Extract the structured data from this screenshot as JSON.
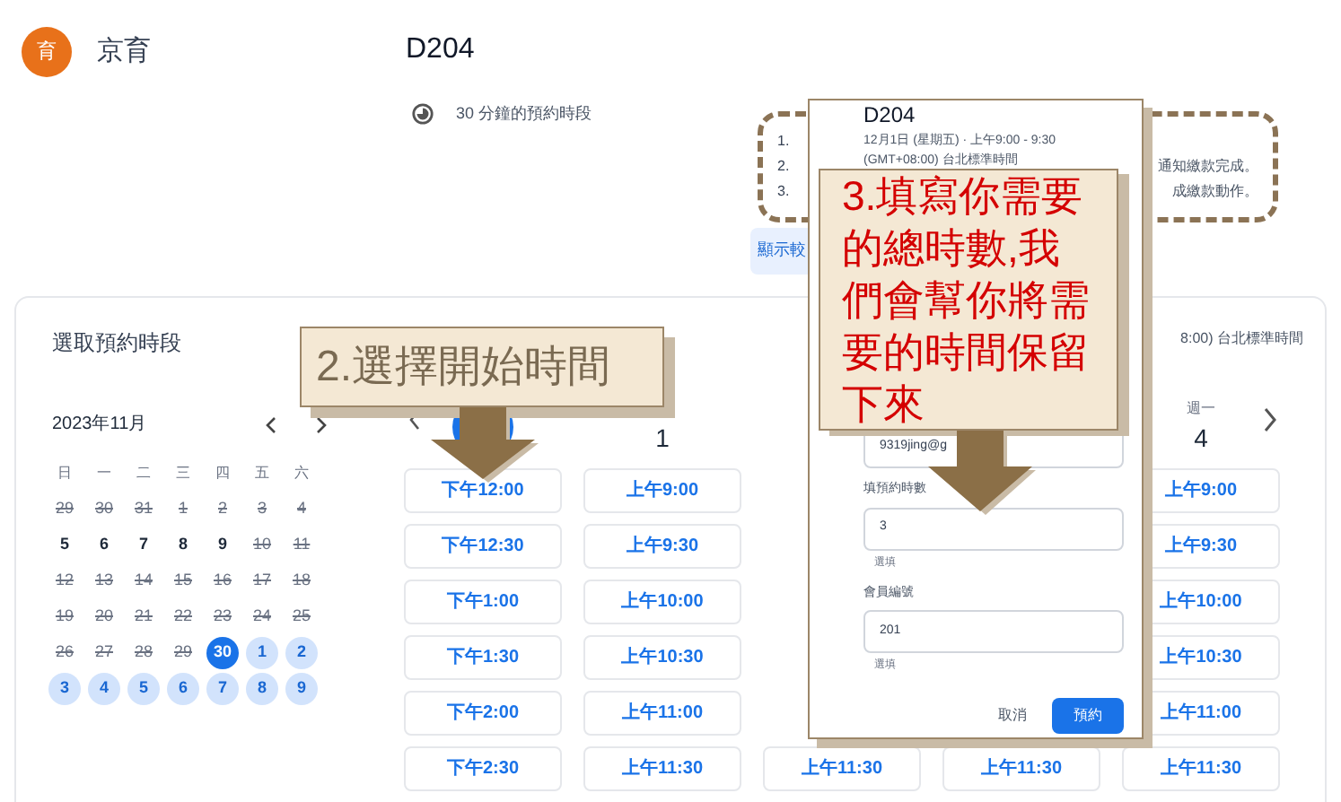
{
  "header": {
    "avatar": "育",
    "org": "京育"
  },
  "event": {
    "title": "D204",
    "duration": "30 分鐘的預約時段"
  },
  "notes": [
    {
      "number": "1."
    },
    {
      "number": "2.",
      "tail": "通知繳款完成。"
    },
    {
      "number": "3.",
      "tail": "成繳款動作。"
    }
  ],
  "show_more": "顯示較",
  "calendar": {
    "title": "選取預約時段",
    "month": "2023年11月",
    "weekdays": [
      "日",
      "一",
      "二",
      "三",
      "四",
      "五",
      "六"
    ],
    "weeks": [
      [
        {
          "d": "29",
          "disabled": true,
          "available": false,
          "selected": false
        },
        {
          "d": "30",
          "disabled": true,
          "available": false,
          "selected": false
        },
        {
          "d": "31",
          "disabled": true,
          "available": false,
          "selected": false
        },
        {
          "d": "1",
          "disabled": true,
          "available": false,
          "selected": false
        },
        {
          "d": "2",
          "disabled": true,
          "available": false,
          "selected": false
        },
        {
          "d": "3",
          "disabled": true,
          "available": false,
          "selected": false
        },
        {
          "d": "4",
          "disabled": true,
          "available": false,
          "selected": false
        }
      ],
      [
        {
          "d": "5",
          "disabled": false,
          "available": false,
          "selected": false
        },
        {
          "d": "6",
          "disabled": false,
          "available": false,
          "selected": false
        },
        {
          "d": "7",
          "disabled": false,
          "available": false,
          "selected": false
        },
        {
          "d": "8",
          "disabled": false,
          "available": false,
          "selected": false
        },
        {
          "d": "9",
          "disabled": false,
          "available": false,
          "selected": false
        },
        {
          "d": "10",
          "disabled": true,
          "available": false,
          "selected": false
        },
        {
          "d": "11",
          "disabled": true,
          "available": false,
          "selected": false
        }
      ],
      [
        {
          "d": "12",
          "disabled": true,
          "available": false,
          "selected": false
        },
        {
          "d": "13",
          "disabled": true,
          "available": false,
          "selected": false
        },
        {
          "d": "14",
          "disabled": true,
          "available": false,
          "selected": false
        },
        {
          "d": "15",
          "disabled": true,
          "available": false,
          "selected": false
        },
        {
          "d": "16",
          "disabled": true,
          "available": false,
          "selected": false
        },
        {
          "d": "17",
          "disabled": true,
          "available": false,
          "selected": false
        },
        {
          "d": "18",
          "disabled": true,
          "available": false,
          "selected": false
        }
      ],
      [
        {
          "d": "19",
          "disabled": true,
          "available": false,
          "selected": false
        },
        {
          "d": "20",
          "disabled": true,
          "available": false,
          "selected": false
        },
        {
          "d": "21",
          "disabled": true,
          "available": false,
          "selected": false
        },
        {
          "d": "22",
          "disabled": true,
          "available": false,
          "selected": false
        },
        {
          "d": "23",
          "disabled": true,
          "available": false,
          "selected": false
        },
        {
          "d": "24",
          "disabled": true,
          "available": false,
          "selected": false
        },
        {
          "d": "25",
          "disabled": true,
          "available": false,
          "selected": false
        }
      ],
      [
        {
          "d": "26",
          "disabled": true,
          "available": false,
          "selected": false
        },
        {
          "d": "27",
          "disabled": true,
          "available": false,
          "selected": false
        },
        {
          "d": "28",
          "disabled": true,
          "available": false,
          "selected": false
        },
        {
          "d": "29",
          "disabled": true,
          "available": false,
          "selected": false
        },
        {
          "d": "30",
          "disabled": false,
          "available": true,
          "selected": true
        },
        {
          "d": "1",
          "disabled": false,
          "available": true,
          "selected": false
        },
        {
          "d": "2",
          "disabled": false,
          "available": true,
          "selected": false
        }
      ],
      [
        {
          "d": "3",
          "disabled": false,
          "available": true,
          "selected": false
        },
        {
          "d": "4",
          "disabled": false,
          "available": true,
          "selected": false
        },
        {
          "d": "5",
          "disabled": false,
          "available": true,
          "selected": false
        },
        {
          "d": "6",
          "disabled": false,
          "available": true,
          "selected": false
        },
        {
          "d": "7",
          "disabled": false,
          "available": true,
          "selected": false
        },
        {
          "d": "8",
          "disabled": false,
          "available": true,
          "selected": false
        },
        {
          "d": "9",
          "disabled": false,
          "available": true,
          "selected": false
        }
      ]
    ]
  },
  "schedule": {
    "timezone": "8:00) 台北標準時間",
    "days": [
      {
        "selected": true,
        "slots": [
          "下午12:00",
          "下午12:30",
          "下午1:00",
          "下午1:30",
          "下午2:00",
          "下午2:30"
        ]
      },
      {
        "date": "1",
        "selected": false,
        "slots": [
          "上午9:00",
          "上午9:30",
          "上午10:00",
          "上午10:30",
          "上午11:00",
          "上午11:30"
        ]
      },
      {
        "slots": [
          "上午11:30"
        ]
      },
      {
        "slots": [
          "上午11:30"
        ]
      },
      {
        "weekday": "週一",
        "date": "4",
        "selected": false,
        "slots": [
          "上午9:00",
          "上午9:30",
          "上午10:00",
          "上午10:30",
          "上午11:00",
          "上午11:30"
        ]
      }
    ]
  },
  "dialog": {
    "title": "D204",
    "datetime": "12月1日 (星期五) · 上午9:00 - 9:30",
    "timezone": "(GMT+08:00) 台北標準時間",
    "fields": [
      {
        "value": "9319jing@g"
      },
      {
        "label": "填預約時數",
        "value": "3",
        "hint": "選填"
      },
      {
        "label": "會員編號",
        "value": "201",
        "hint": "選填"
      }
    ],
    "cancel": "取消",
    "submit": "預約"
  },
  "annotations": [
    {
      "kind": "short",
      "text": "2.選擇開始時間",
      "color": "#7a6a52"
    },
    {
      "kind": "tall",
      "text": "3.填寫你需要的總時數,我們會幫你將需要的時間保留下來",
      "color": "#d40000"
    }
  ]
}
